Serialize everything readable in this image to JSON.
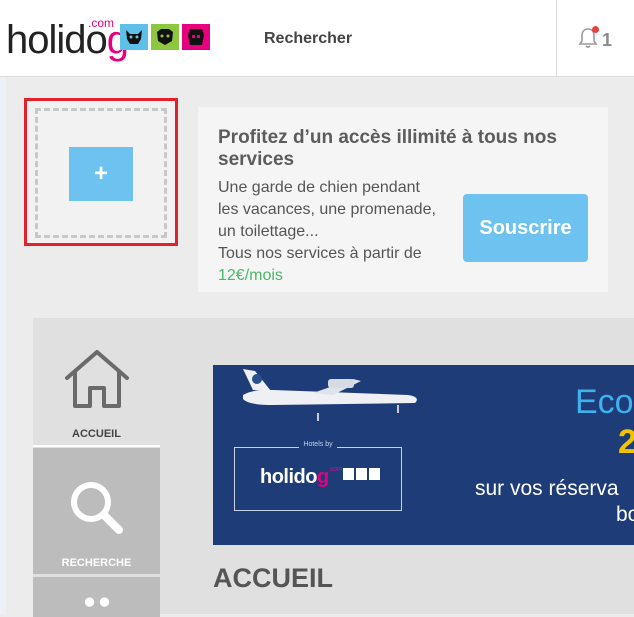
{
  "header": {
    "logo_text_a": "holido",
    "logo_text_b": "g",
    "logo_com": ".com",
    "search_label": "Rechercher",
    "notification_count": "1"
  },
  "add_box": {
    "button_label": "+"
  },
  "promo": {
    "title": "Profitez d’un accès illimité à tous nos services",
    "desc_line": "Une garde de chien pendant les vacances, une promenade, un toilettage...",
    "desc_price_prefix": "Tous nos services à partir de",
    "price": "12€/mois",
    "button_label": "Souscrire"
  },
  "nav": {
    "items": [
      {
        "label": "ACCUEIL"
      },
      {
        "label": "RECHERCHE"
      }
    ]
  },
  "banner": {
    "caption": "Hotels by",
    "logo_a": "holido",
    "logo_b": "g",
    "logo_com": ".com",
    "text_eco": "Eco",
    "text_2": "2",
    "text_sur": "sur vos réserva",
    "text_bo": "bo"
  },
  "page_title": "ACCUEIL",
  "colors": {
    "accent": "#6ec2ef",
    "brand_pink": "#e6007e",
    "highlight_red": "#e4202b",
    "price_green": "#4cb86a"
  }
}
